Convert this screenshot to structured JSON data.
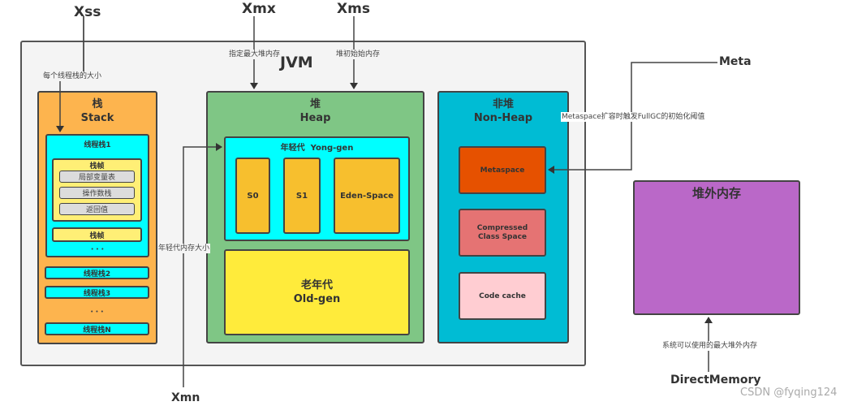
{
  "params": {
    "xss": "Xss",
    "xmx": "Xmx",
    "xms": "Xms",
    "xmn": "Xmn",
    "meta": "Meta",
    "direct_memory": "DirectMemory"
  },
  "notes": {
    "xss": "每个线程栈的大小",
    "xmx": "指定最大堆内存",
    "xms": "堆初始始内存",
    "xmn": "年轻代内存大小",
    "meta": "Metaspace扩容时触发FullGC的初始化阈值",
    "direct_memory": "系统可以使用的最大堆外内存"
  },
  "jvm": {
    "title": "JVM",
    "stack": {
      "title_cn": "栈",
      "title_en": "Stack",
      "thread1": {
        "label": "线程栈1",
        "frame": {
          "label": "栈帧",
          "items": [
            "局部变量表",
            "操作数栈",
            "返回值"
          ]
        },
        "frame2": "栈帧",
        "ellipsis": "• • •"
      },
      "threads": [
        "线程栈2",
        "线程栈3"
      ],
      "ellipsis": "• • •",
      "thread_n": "线程栈N"
    },
    "heap": {
      "title_cn": "堆",
      "title_en": "Heap",
      "young": {
        "label": "年轻代  Yong-gen",
        "s0": "S0",
        "s1": "S1",
        "eden": "Eden-Space"
      },
      "old": {
        "label_cn": "老年代",
        "label_en": "Old-gen"
      }
    },
    "non_heap": {
      "title_cn": "非堆",
      "title_en": "Non-Heap",
      "metaspace": "Metaspace",
      "ccs": "Compressed Class Space",
      "code_cache": "Code cache"
    }
  },
  "direct": {
    "title": "堆外内存"
  },
  "watermark": "CSDN @fyqing124",
  "colors": {
    "jvm_bg": "#f4f4f4",
    "stack": "#fdb44e",
    "cyan": "#00ffff",
    "frame": "#ffef76",
    "frame_item": "#dcdcdc",
    "heap": "#7fc685",
    "young_item": "#f7bf2e",
    "old": "#ffeb3b",
    "non_heap": "#00bcd4",
    "metaspace": "#e65100",
    "ccs": "#e57373",
    "code_cache": "#ffcdd2",
    "direct": "#ba68c8"
  }
}
